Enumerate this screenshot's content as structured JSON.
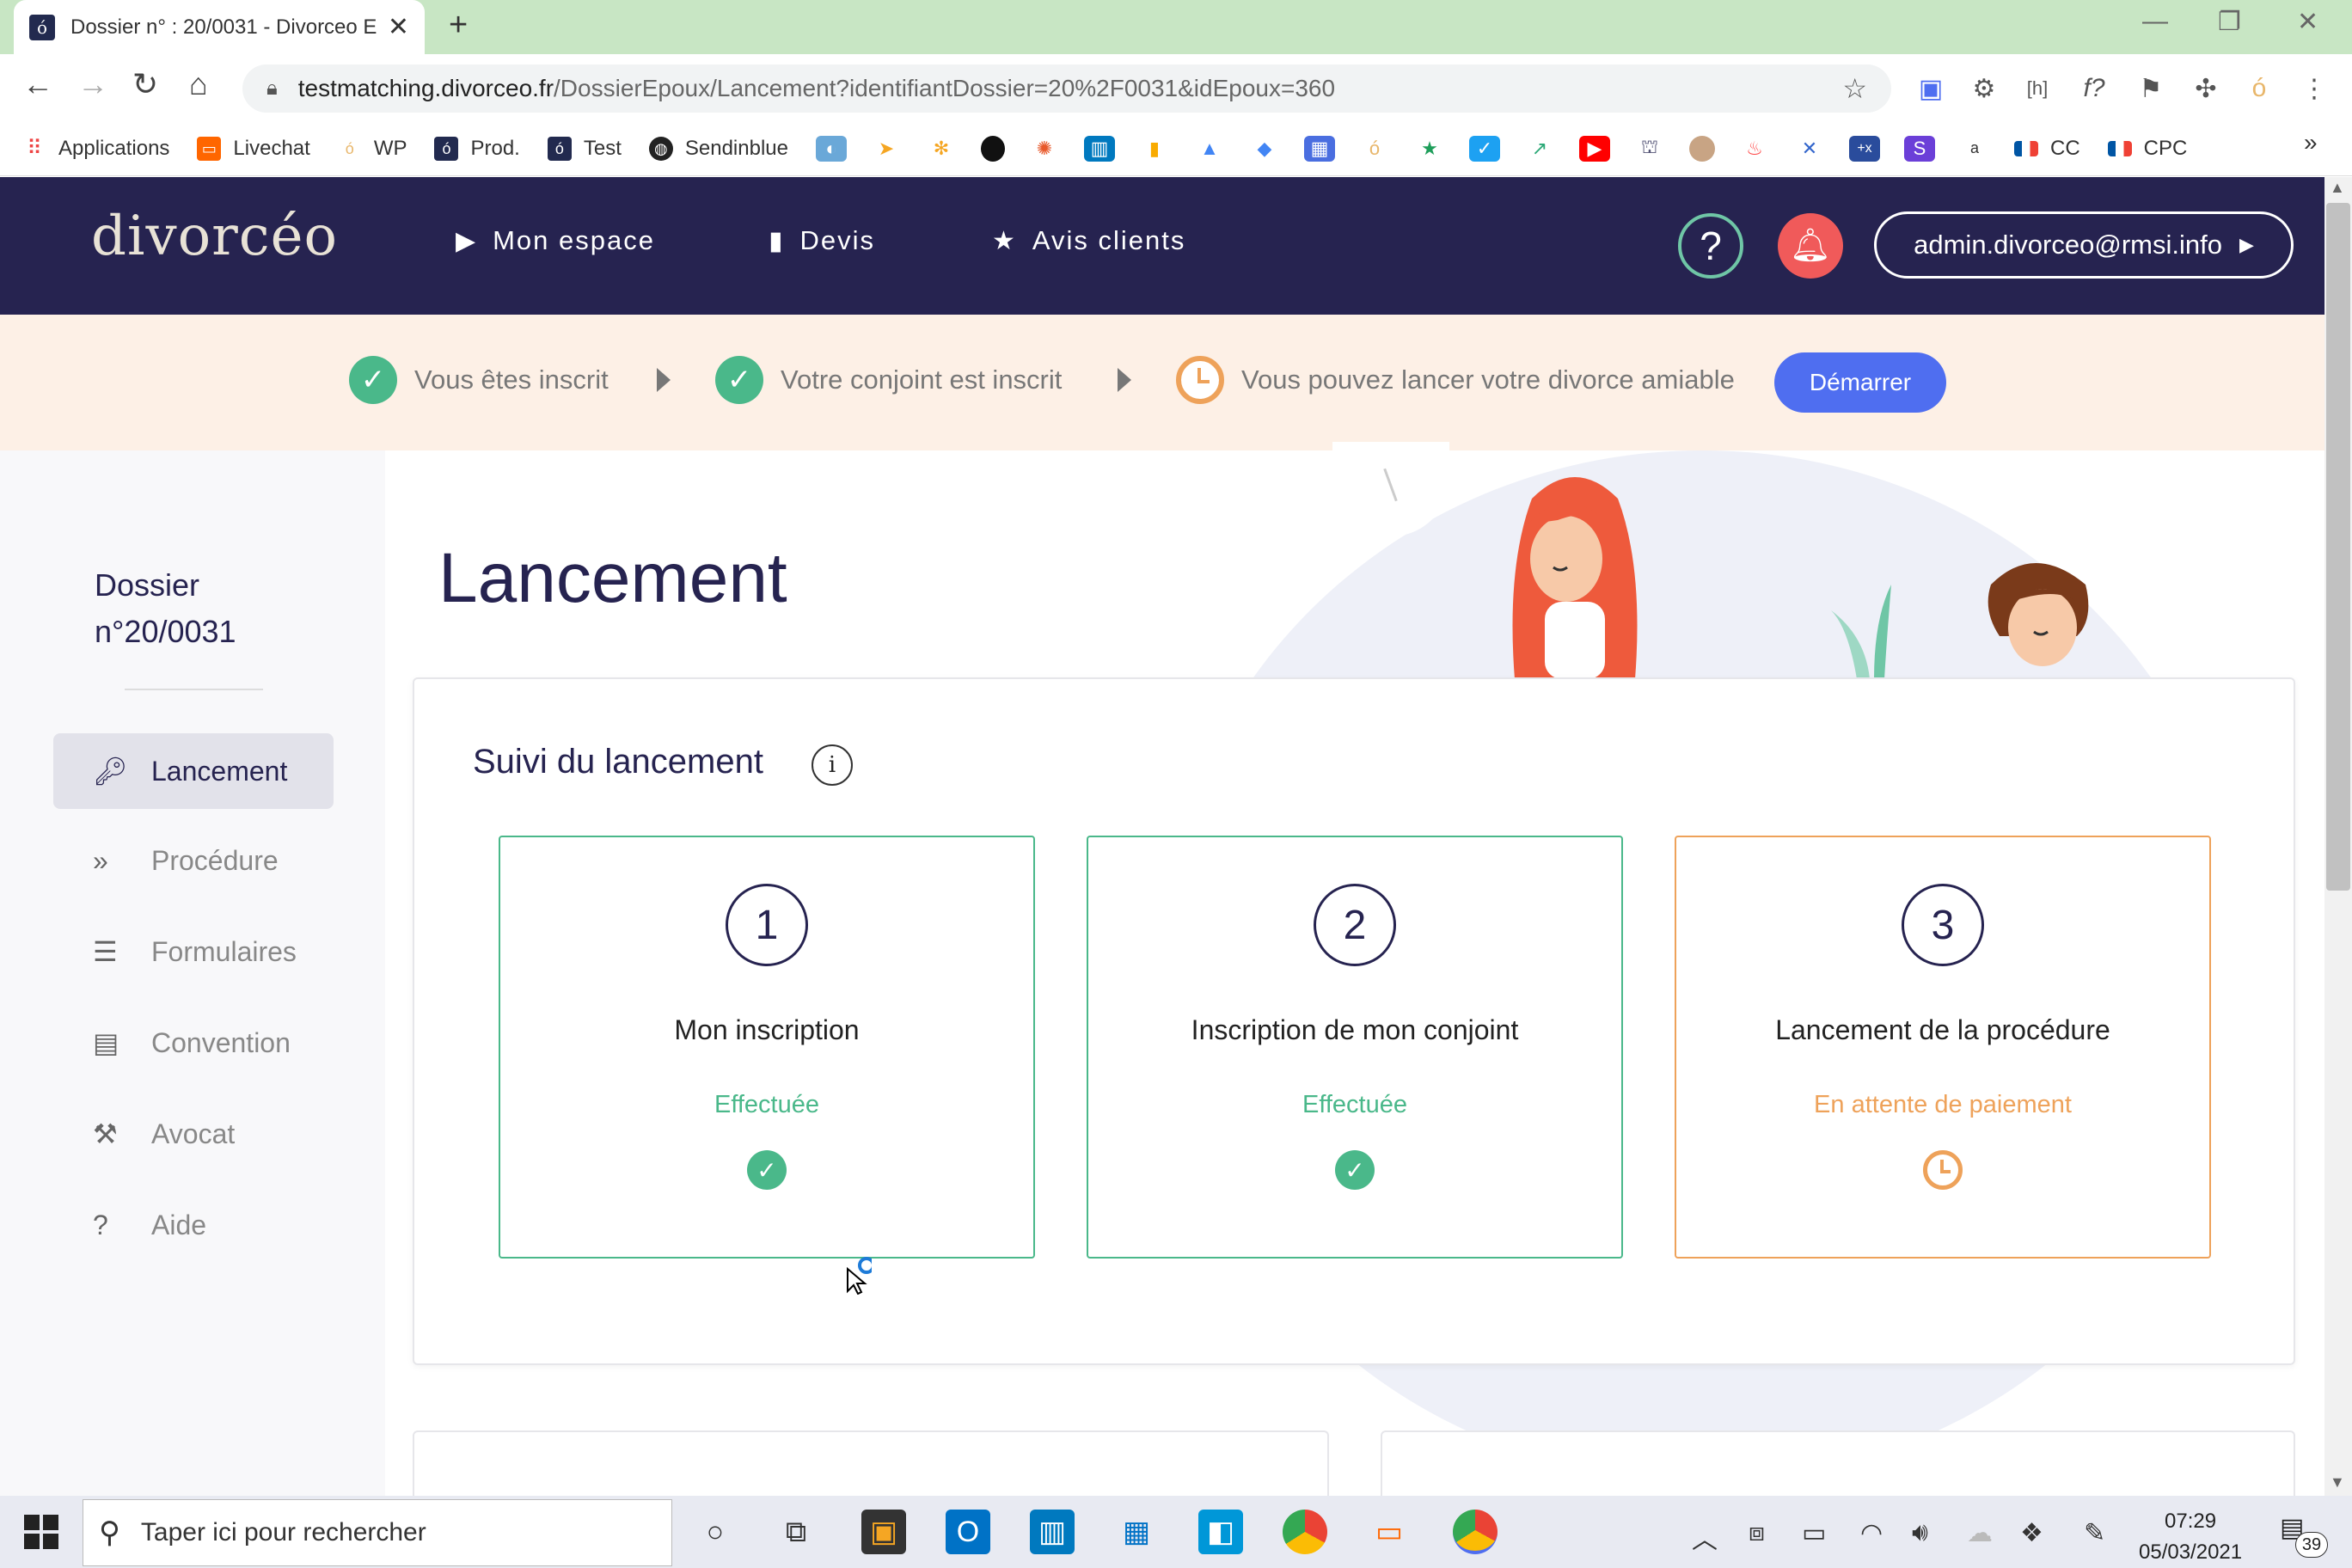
{
  "browser": {
    "tab_title": "Dossier n° : 20/0031 - Divorceo E",
    "url_host": "testmatching.divorceo.fr",
    "url_path": "/DossierEpoux/Lancement?identifiantDossier=20%2F0031&idEpoux=360",
    "bookmarks": [
      "Applications",
      "Livechat",
      "WP",
      "Prod.",
      "Test",
      "Sendinblue",
      "CC",
      "CPC"
    ]
  },
  "site": {
    "logo": "divorcéo",
    "nav": [
      "Mon espace",
      "Devis",
      "Avis clients"
    ],
    "admin_email": "admin.divorceo@rmsi.info"
  },
  "steps": {
    "step1": "Vous êtes inscrit",
    "step2": "Votre conjoint est inscrit",
    "step3": "Vous pouvez lancer votre divorce amiable",
    "start_button": "Démarrer"
  },
  "sidebar": {
    "dossier_line1": "Dossier",
    "dossier_line2": "n°20/0031",
    "items": [
      {
        "label": "Lancement",
        "active": true
      },
      {
        "label": "Procédure",
        "active": false
      },
      {
        "label": "Formulaires",
        "active": false
      },
      {
        "label": "Convention",
        "active": false
      },
      {
        "label": "Avocat",
        "active": false
      },
      {
        "label": "Aide",
        "active": false
      }
    ]
  },
  "main": {
    "title": "Lancement",
    "card_title": "Suivi du lancement",
    "info_icon": "i",
    "stages": [
      {
        "num": "1",
        "name": "Mon inscription",
        "status": "Effectuée"
      },
      {
        "num": "2",
        "name": "Inscription de mon conjoint",
        "status": "Effectuée"
      },
      {
        "num": "3",
        "name": "Lancement de la procédure",
        "status": "En attente de paiement"
      }
    ]
  },
  "taskbar": {
    "search_placeholder": "Taper ici pour rechercher",
    "time": "07:29",
    "date": "05/03/2021",
    "notifications": "39"
  },
  "colors": {
    "header_bg": "#262350",
    "step_bar_bg": "#fdf0e6",
    "success_green": "#4ab88a",
    "pending_orange": "#eea25a",
    "primary_blue": "#4f6ef0",
    "alert_red": "#f05a5a"
  }
}
